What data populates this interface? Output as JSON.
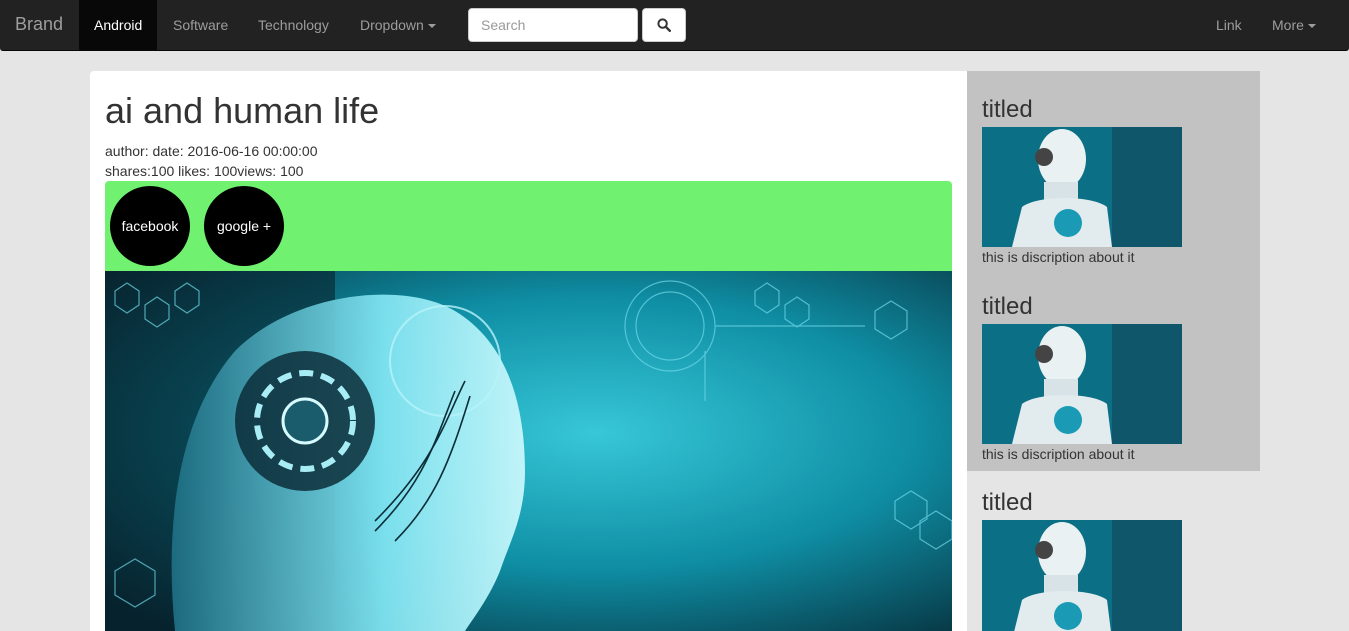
{
  "navbar": {
    "brand": "Brand",
    "items": [
      {
        "label": "Android",
        "active": true
      },
      {
        "label": "Software"
      },
      {
        "label": "Technology"
      },
      {
        "label": "Dropdown"
      }
    ],
    "search_placeholder": "Search",
    "search_icon": "search-icon",
    "right_items": [
      {
        "label": "Link"
      },
      {
        "label": "More"
      }
    ]
  },
  "article": {
    "title": "ai and human life",
    "meta_line1": "author: date: 2016-06-16 00:00:00",
    "meta_line2": "shares:100 likes: 100views: 100",
    "share_buttons": [
      "facebook",
      "google +"
    ],
    "share_bar_color": "#70f170"
  },
  "sidebar": {
    "items": [
      {
        "title": "titled",
        "description": "this is discription about it"
      },
      {
        "title": "titled",
        "description": "this is discription about it"
      },
      {
        "title": "titled",
        "description": ""
      }
    ]
  },
  "colors": {
    "navbar_bg": "#222222",
    "page_bg": "#e5e5e5",
    "sidebar_bg": "#c2c2c2",
    "accent_teal": "#1aa3b8"
  }
}
